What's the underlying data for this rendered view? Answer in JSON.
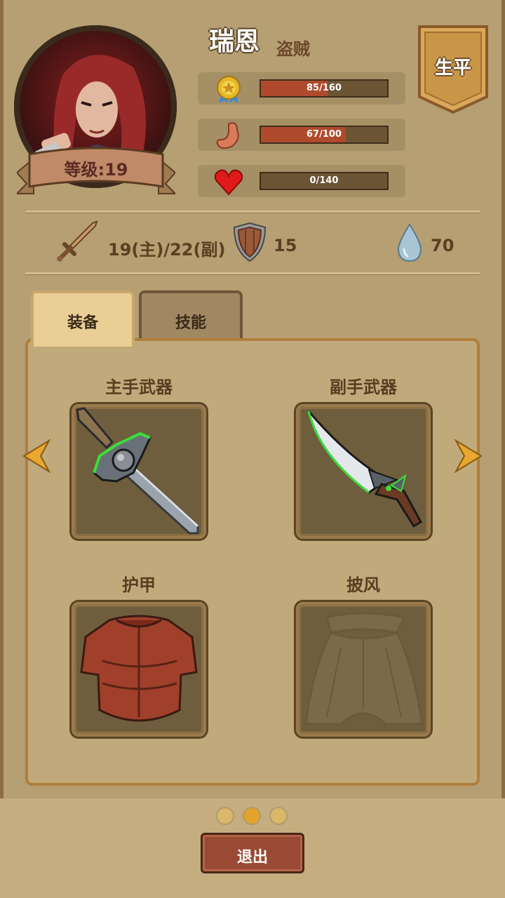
{
  "character": {
    "name": "瑞恩",
    "class": "盗贼",
    "level_label": "等级:19"
  },
  "bio_button": "生平",
  "stats": [
    {
      "icon": "medal-icon",
      "text": "85/160",
      "fill": 0.53,
      "color": "#b04a2c"
    },
    {
      "icon": "stomach-icon",
      "text": "67/100",
      "fill": 0.67,
      "color": "#b04a2c"
    },
    {
      "icon": "heart-icon",
      "text": "0/140",
      "fill": 0.0,
      "color": "#b04a2c"
    }
  ],
  "attributes": {
    "attack": "19(主)/22(副)",
    "defense": "15",
    "water": "70"
  },
  "tabs": {
    "equipment": "装备",
    "skills": "技能"
  },
  "slots": {
    "main_weapon": "主手武器",
    "off_weapon": "副手武器",
    "armor": "护甲",
    "cloak": "披风"
  },
  "pagination": {
    "pages": 3,
    "current": 2,
    "active_color": "#e3a32a",
    "inactive_color": "#d9b86a"
  },
  "exit_button": "退出"
}
